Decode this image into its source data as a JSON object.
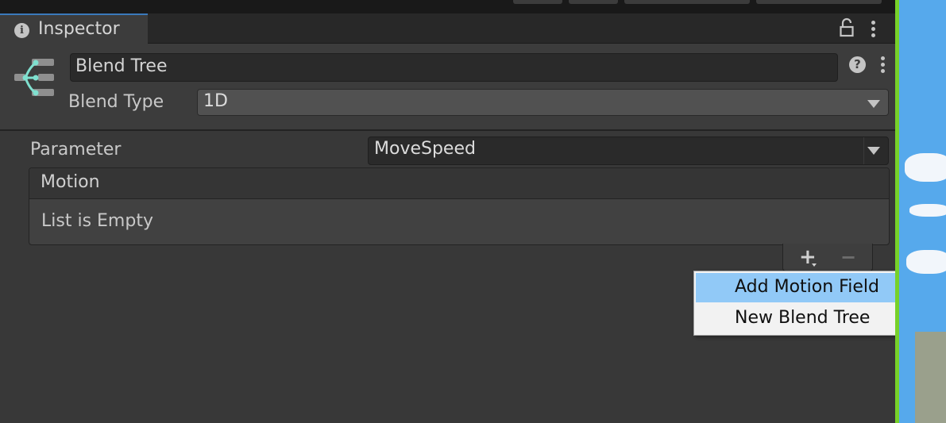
{
  "tab": {
    "title": "Inspector",
    "icon": "info-icon"
  },
  "toolbar_icons": [
    "lock-icon",
    "kebab-menu-icon"
  ],
  "asset": {
    "icon": "blend-tree-icon",
    "name": "Blend Tree"
  },
  "blend_type": {
    "label": "Blend Type",
    "value": "1D"
  },
  "parameter": {
    "label": "Parameter",
    "value": "MoveSpeed"
  },
  "motion_list": {
    "header": "Motion",
    "empty_text": "List is Empty",
    "add_icon": "plus-icon",
    "remove_icon": "minus-icon"
  },
  "context_menu": {
    "items": [
      {
        "label": "Add Motion Field",
        "highlighted": true
      },
      {
        "label": "New Blend Tree",
        "highlighted": false
      }
    ]
  },
  "colors": {
    "panel": "#3c3c3c",
    "accent_tab": "#3a79bb",
    "menu_highlight": "#91c9f7",
    "blend_tree_icon": "#7fe0cf"
  }
}
